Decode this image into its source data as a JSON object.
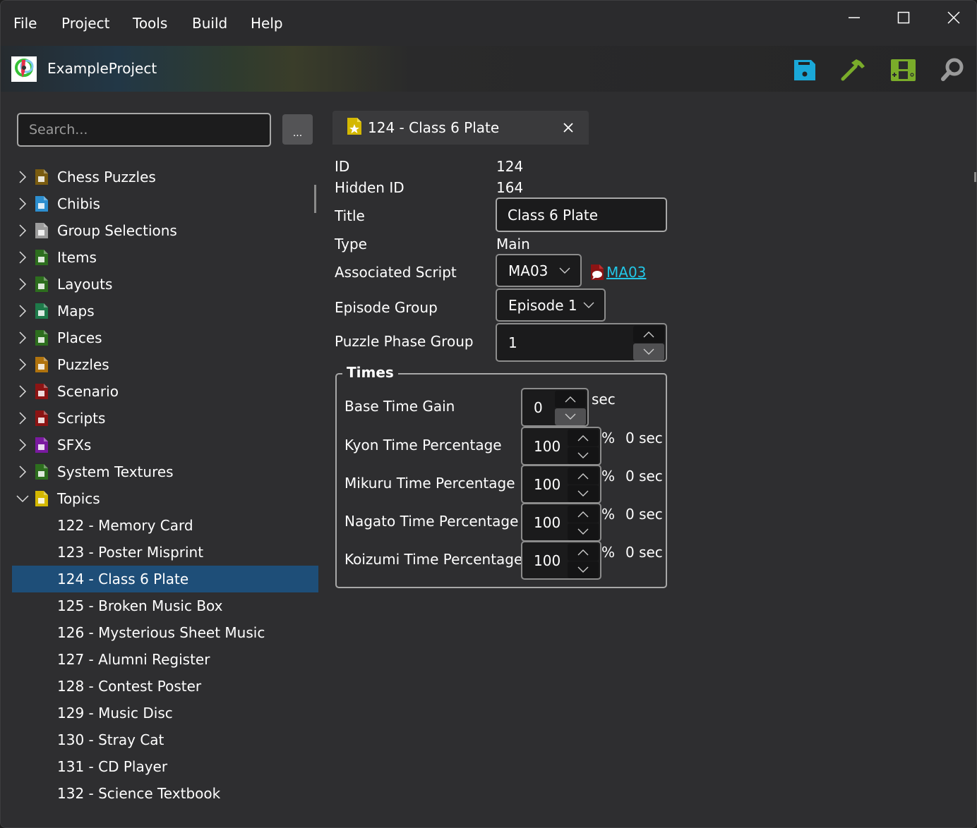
{
  "menu": [
    "File",
    "Project",
    "Tools",
    "Build",
    "Help"
  ],
  "window_controls": {
    "minimize": "minimize-icon",
    "maximize": "maximize-icon",
    "close": "close-icon"
  },
  "project": {
    "name": "ExampleProject",
    "logo": "project-logo-icon"
  },
  "toolbar": {
    "save": {
      "icon": "save-icon",
      "color": "#1aa8d8"
    },
    "build": {
      "icon": "hammer-icon",
      "color": "#7aac2a"
    },
    "run": {
      "icon": "handheld-console-icon",
      "color": "#7aac2a"
    },
    "search": {
      "icon": "search-icon",
      "color": "#9a9a9a"
    }
  },
  "sidebar": {
    "search_placeholder": "Search...",
    "more_button": "...",
    "categories": [
      {
        "label": "Chess Puzzles",
        "icon": "chess-icon",
        "color": "#7a5c10",
        "expanded": false
      },
      {
        "label": "Chibis",
        "icon": "chibi-icon",
        "color": "#2c8ecf",
        "expanded": false
      },
      {
        "label": "Group Selections",
        "icon": "group-icon",
        "color": "#9c9c9c",
        "expanded": false
      },
      {
        "label": "Items",
        "icon": "gift-icon",
        "color": "#2d6e1e",
        "expanded": false
      },
      {
        "label": "Layouts",
        "icon": "layout-gear-icon",
        "color": "#2d6e1e",
        "expanded": false
      },
      {
        "label": "Maps",
        "icon": "map-eye-icon",
        "color": "#1e7a4a",
        "expanded": false
      },
      {
        "label": "Places",
        "icon": "location-pin-icon",
        "color": "#2d6e1e",
        "expanded": false
      },
      {
        "label": "Puzzles",
        "icon": "puzzle-icon",
        "color": "#b0730e",
        "expanded": false
      },
      {
        "label": "Scenario",
        "icon": "alert-icon",
        "color": "#8c1414",
        "expanded": false
      },
      {
        "label": "Scripts",
        "icon": "speech-bubble-icon",
        "color": "#8c1414",
        "expanded": false
      },
      {
        "label": "SFXs",
        "icon": "sound-icon",
        "color": "#7a1aa0",
        "expanded": false
      },
      {
        "label": "System Textures",
        "icon": "texture-icon",
        "color": "#2d6e1e",
        "expanded": false
      },
      {
        "label": "Topics",
        "icon": "star-icon",
        "color": "#d4b800",
        "expanded": true
      }
    ],
    "topics": [
      "122 - Memory Card",
      "123 - Poster Misprint",
      "124 - Class 6 Plate",
      "125 - Broken Music Box",
      "126 - Mysterious Sheet Music",
      "127 - Alumni Register",
      "128 - Contest Poster",
      "129 - Music Disc",
      "130 - Stray Cat",
      "131 - CD Player",
      "132 - Science Textbook"
    ],
    "selected_topic": "124 - Class 6 Plate"
  },
  "editor": {
    "tab_title": "124 - Class 6 Plate",
    "fields": {
      "id_label": "ID",
      "id_value": "124",
      "hidden_id_label": "Hidden ID",
      "hidden_id_value": "164",
      "title_label": "Title",
      "title_value": "Class 6 Plate",
      "type_label": "Type",
      "type_value": "Main",
      "script_label": "Associated Script",
      "script_value": "MA03",
      "script_link": "MA03",
      "episode_label": "Episode Group",
      "episode_value": "Episode 1",
      "phase_label": "Puzzle Phase Group",
      "phase_value": "1"
    },
    "times": {
      "title": "Times",
      "base_label": "Base Time Gain",
      "base_value": "0",
      "base_unit": "sec",
      "rows": [
        {
          "label": "Kyon Time Percentage",
          "value": "100",
          "unit": "%",
          "computed": "0 sec"
        },
        {
          "label": "Mikuru Time Percentage",
          "value": "100",
          "unit": "%",
          "computed": "0 sec"
        },
        {
          "label": "Nagato Time Percentage",
          "value": "100",
          "unit": "%",
          "computed": "0 sec"
        },
        {
          "label": "Koizumi Time Percentage",
          "value": "100",
          "unit": "%",
          "computed": "0 sec"
        }
      ]
    }
  }
}
